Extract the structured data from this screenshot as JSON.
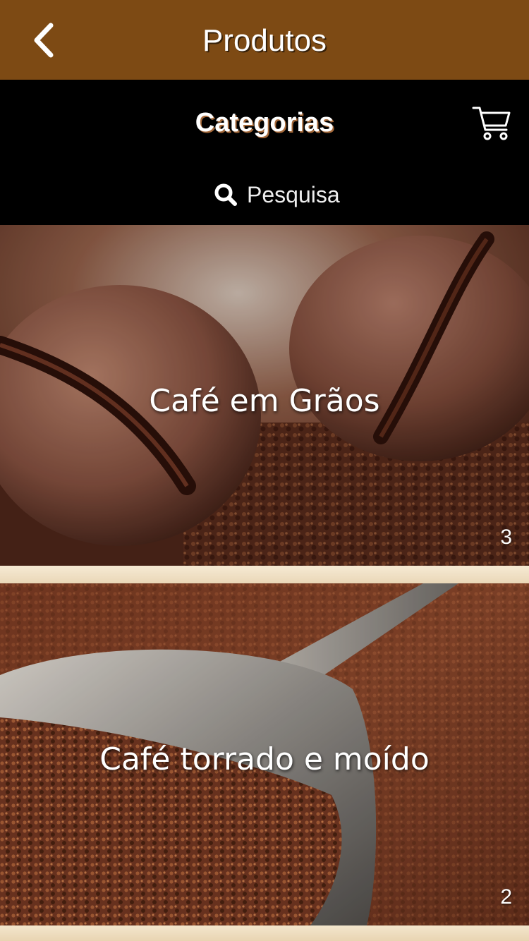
{
  "header": {
    "title": "Produtos",
    "back_icon": "chevron-left-icon"
  },
  "subheader": {
    "title": "Categorias",
    "cart_icon": "cart-icon"
  },
  "search": {
    "placeholder": "Pesquisa",
    "icon": "search-icon"
  },
  "categories": [
    {
      "label": "Café em Grãos",
      "count": "3"
    },
    {
      "label": "Café torrado e moído",
      "count": "2"
    }
  ],
  "colors": {
    "header_bg": "#7d4a14",
    "subheader_bg": "#000000",
    "page_bg": "#f1e3c8",
    "title_shadow": "#a5693a"
  }
}
